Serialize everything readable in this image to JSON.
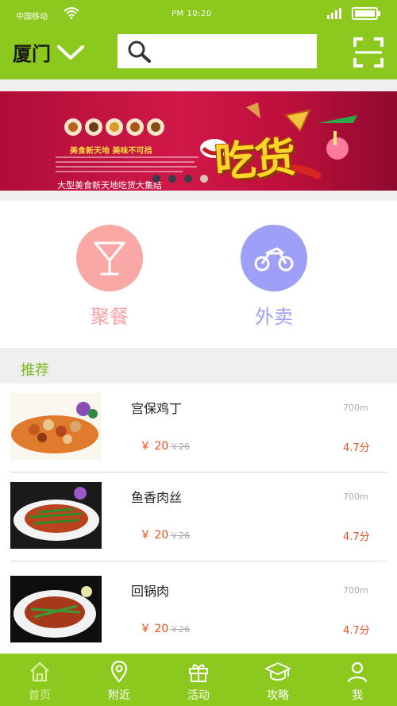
{
  "status_bar": {
    "carrier": "中国移动",
    "time": "PM 10:20"
  },
  "header": {
    "city": "厦门",
    "search_placeholder": ""
  },
  "banner": {
    "tagline": "美食新天地 美味不可挡",
    "caption": "大型美食新天地吃货大集结",
    "headline": "吃货",
    "dots": 4,
    "active_dot": 4
  },
  "services": [
    {
      "label": "聚餐",
      "icon": "cocktail-glass-icon"
    },
    {
      "label": "外卖",
      "icon": "motorcycle-icon"
    }
  ],
  "recommend": {
    "title": "推荐",
    "items": [
      {
        "name": "宫保鸡丁",
        "distance": "700m",
        "price": "￥ 20",
        "original_price": "￥26",
        "rating": "4.7分"
      },
      {
        "name": "鱼香肉丝",
        "distance": "700m",
        "price": "￥ 20",
        "original_price": "￥26",
        "rating": "4.7分"
      },
      {
        "name": "回锅肉",
        "distance": "700m",
        "price": "￥ 20",
        "original_price": "￥26",
        "rating": "4.7分"
      }
    ]
  },
  "tabbar": {
    "tabs": [
      {
        "label": "首页",
        "icon": "home-icon",
        "active": true
      },
      {
        "label": "附近",
        "icon": "location-pin-icon",
        "active": false
      },
      {
        "label": "活动",
        "icon": "gift-icon",
        "active": false
      },
      {
        "label": "攻略",
        "icon": "graduation-cap-icon",
        "active": false
      },
      {
        "label": "我",
        "icon": "person-icon",
        "active": false
      }
    ]
  },
  "colors": {
    "primary_green": "#8cc81e",
    "accent_orange": "#e8501e",
    "dine_pink": "#f9a8a6",
    "delivery_purple": "#9ea0f7"
  }
}
